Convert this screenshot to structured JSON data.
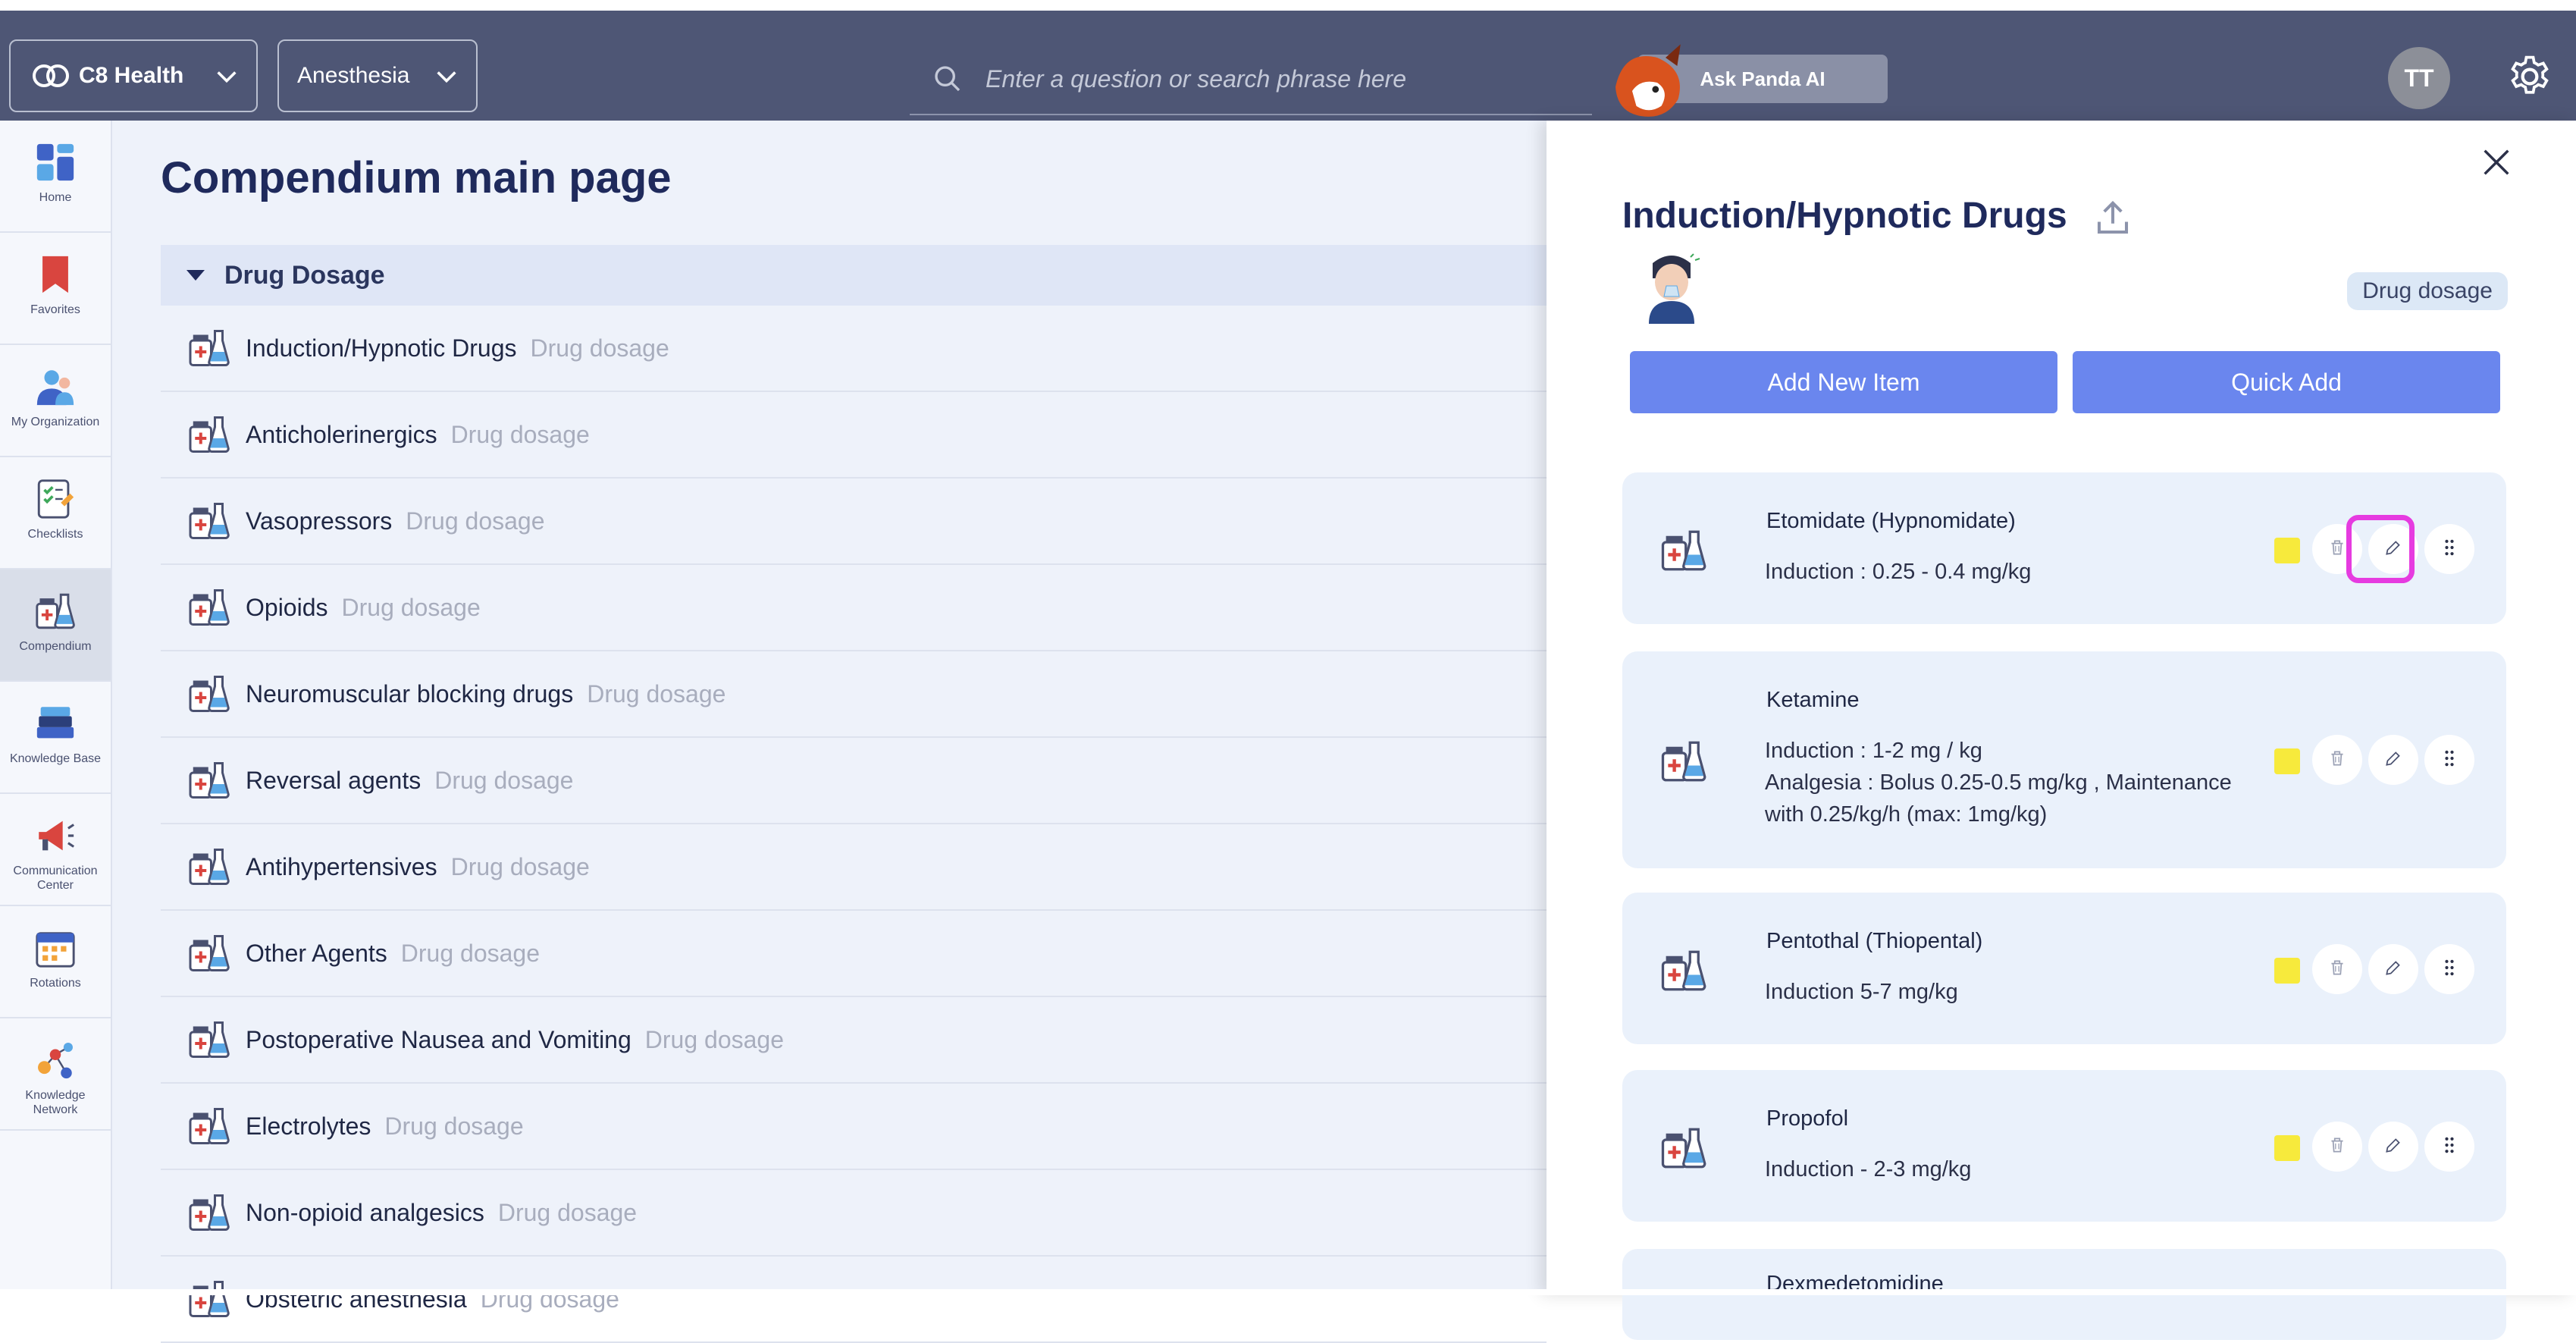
{
  "topbar": {
    "org_label": "C8 Health",
    "specialty_label": "Anesthesia",
    "search_placeholder": "Enter a question or search phrase here",
    "ask_label": "Ask Panda AI",
    "avatar_initials": "TT"
  },
  "sidebar": {
    "items": [
      {
        "label": "Home",
        "icon": "home-grid-icon"
      },
      {
        "label": "Favorites",
        "icon": "bookmark-icon"
      },
      {
        "label": "My Organization",
        "icon": "people-icon"
      },
      {
        "label": "Checklists",
        "icon": "checklist-icon"
      },
      {
        "label": "Compendium",
        "icon": "compendium-icon",
        "active": true
      },
      {
        "label": "Knowledge Base",
        "icon": "books-icon"
      },
      {
        "label": "Communication Center",
        "icon": "megaphone-icon"
      },
      {
        "label": "Rotations",
        "icon": "calendar-icon"
      },
      {
        "label": "Knowledge Network",
        "icon": "network-icon"
      }
    ]
  },
  "main": {
    "title": "Compendium main page",
    "section_title": "Drug Dosage",
    "rows": [
      {
        "name": "Induction/Hypnotic Drugs",
        "tag": "Drug dosage"
      },
      {
        "name": "Anticholerinergics",
        "tag": "Drug dosage"
      },
      {
        "name": "Vasopressors",
        "tag": "Drug dosage"
      },
      {
        "name": "Opioids",
        "tag": "Drug dosage"
      },
      {
        "name": "Neuromuscular blocking drugs",
        "tag": "Drug dosage"
      },
      {
        "name": "Reversal agents",
        "tag": "Drug dosage"
      },
      {
        "name": "Antihypertensives",
        "tag": "Drug dosage"
      },
      {
        "name": "Other Agents",
        "tag": "Drug dosage"
      },
      {
        "name": "Postoperative Nausea and Vomiting",
        "tag": "Drug dosage"
      },
      {
        "name": "Electrolytes",
        "tag": "Drug dosage"
      },
      {
        "name": "Non-opioid analgesics",
        "tag": "Drug dosage"
      },
      {
        "name": "Obstetric anesthesia",
        "tag": "Drug dosage"
      }
    ]
  },
  "panel": {
    "title": "Induction/Hypnotic Drugs",
    "badge": "Drug dosage",
    "add_new_label": "Add New Item",
    "quick_add_label": "Quick Add",
    "cards": [
      {
        "name": "Etomidate (Hypnomidate)",
        "desc": "Induction : 0.25 - 0.4 mg/kg"
      },
      {
        "name": "Ketamine",
        "desc": "Induction : 1-2 mg / kg\nAnalgesia : Bolus 0.25-0.5 mg/kg , Maintenance\nwith 0.25/kg/h (max: 1mg/kg)"
      },
      {
        "name": "Pentothal (Thiopental)",
        "desc": "Induction 5-7 mg/kg"
      },
      {
        "name": "Propofol",
        "desc": "Induction - 2-3 mg/kg"
      },
      {
        "name": "Dexmedetomidine",
        "desc": ""
      }
    ]
  },
  "colors": {
    "topbar": "#4e5675",
    "primary_button": "#6a86ee",
    "title": "#1f2a5c",
    "highlight": "#e63be0",
    "flag": "#f7ea3c"
  }
}
